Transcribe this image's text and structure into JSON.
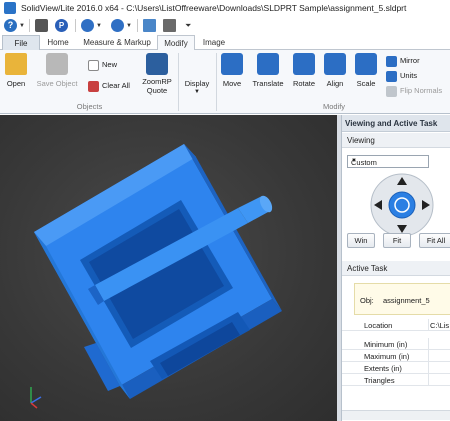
{
  "window": {
    "title": "SolidView/Lite 2016.0 x64  -  C:\\Users\\ListOffreeware\\Downloads\\SLDPRT Sample\\assignment_5.sldprt"
  },
  "tabs": [
    {
      "label": "File"
    },
    {
      "label": "Home"
    },
    {
      "label": "Measure & Markup"
    },
    {
      "label": "Modify"
    },
    {
      "label": "Image"
    }
  ],
  "ribbon": {
    "open": "Open",
    "save_object": "Save Object",
    "new": "New",
    "clear_all": "Clear All",
    "zoomrp_quote": "ZoomRP\nQuote",
    "display": "Display",
    "move": "Move",
    "translate": "Translate",
    "rotate": "Rotate",
    "align": "Align",
    "scale": "Scale",
    "mirror": "Mirror",
    "units": "Units",
    "flip_normals": "Flip Normals",
    "group_objects": "Objects",
    "group_modify": "Modify"
  },
  "panel": {
    "title": "Viewing and Active Task",
    "viewing": "Viewing",
    "view_select": "Custom",
    "win": "Win",
    "fit": "Fit",
    "fit_all": "Fit All",
    "active_task": "Active Task",
    "obj_label": "Obj:",
    "obj_value": "assignment_5",
    "rows": [
      {
        "label": "Location",
        "value": "C:\\Lis"
      },
      {
        "label": "Minimum (in)",
        "value": ""
      },
      {
        "label": "Maximum (in)",
        "value": ""
      },
      {
        "label": "Extents (in)",
        "value": ""
      },
      {
        "label": "Triangles",
        "value": ""
      }
    ]
  },
  "colors": {
    "model": "#2f86f0",
    "viewport_bg": "#3a3a3a",
    "accent": "#2a73c7"
  }
}
